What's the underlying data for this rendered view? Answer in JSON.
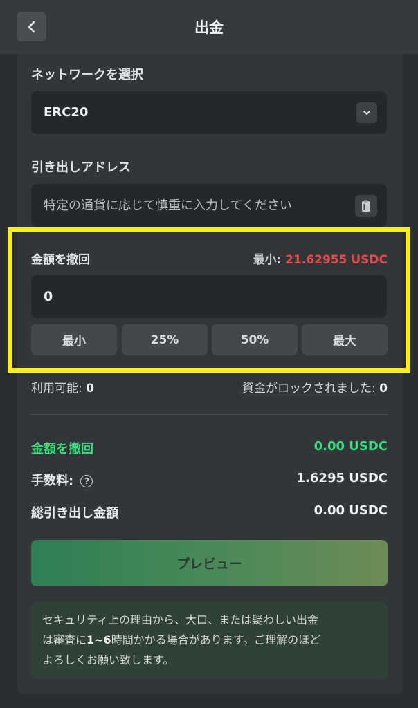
{
  "header": {
    "title": "出金"
  },
  "network": {
    "label": "ネットワークを選択",
    "selected": "ERC20"
  },
  "address": {
    "label": "引き出しアドレス",
    "placeholder": "特定の通貨に応じて慎重に入力してください"
  },
  "amount": {
    "label": "金額を撤回",
    "min_prefix": "最小:",
    "min_value": "21.62955 USDC",
    "value": "0",
    "quick_buttons": [
      "最小",
      "25%",
      "50%",
      "最大"
    ]
  },
  "balance": {
    "available_label": "利用可能:",
    "available_value": "0",
    "locked_label": "資金がロックされました:",
    "locked_value": "0"
  },
  "summary": {
    "withdraw_label": "金額を撤回",
    "withdraw_value": "0.00 USDC",
    "fee_label": "手数料:",
    "fee_value": "1.6295 USDC",
    "total_label": "総引き出し金額",
    "total_value": "0.00 USDC"
  },
  "preview_button": "プレビュー",
  "notice": {
    "line1": "セキュリティ上の理由から、大口、または疑わしい出金",
    "line2_pre": "は審査に",
    "line2_bold": "1~6",
    "line2_post": "時間かかる場合があります。ご理解のほど",
    "line3": "よろしくお願い致します。"
  },
  "colors": {
    "highlight": "#f7ee1a",
    "min_value": "#e5484d",
    "accent_green": "#3ddc7e"
  }
}
